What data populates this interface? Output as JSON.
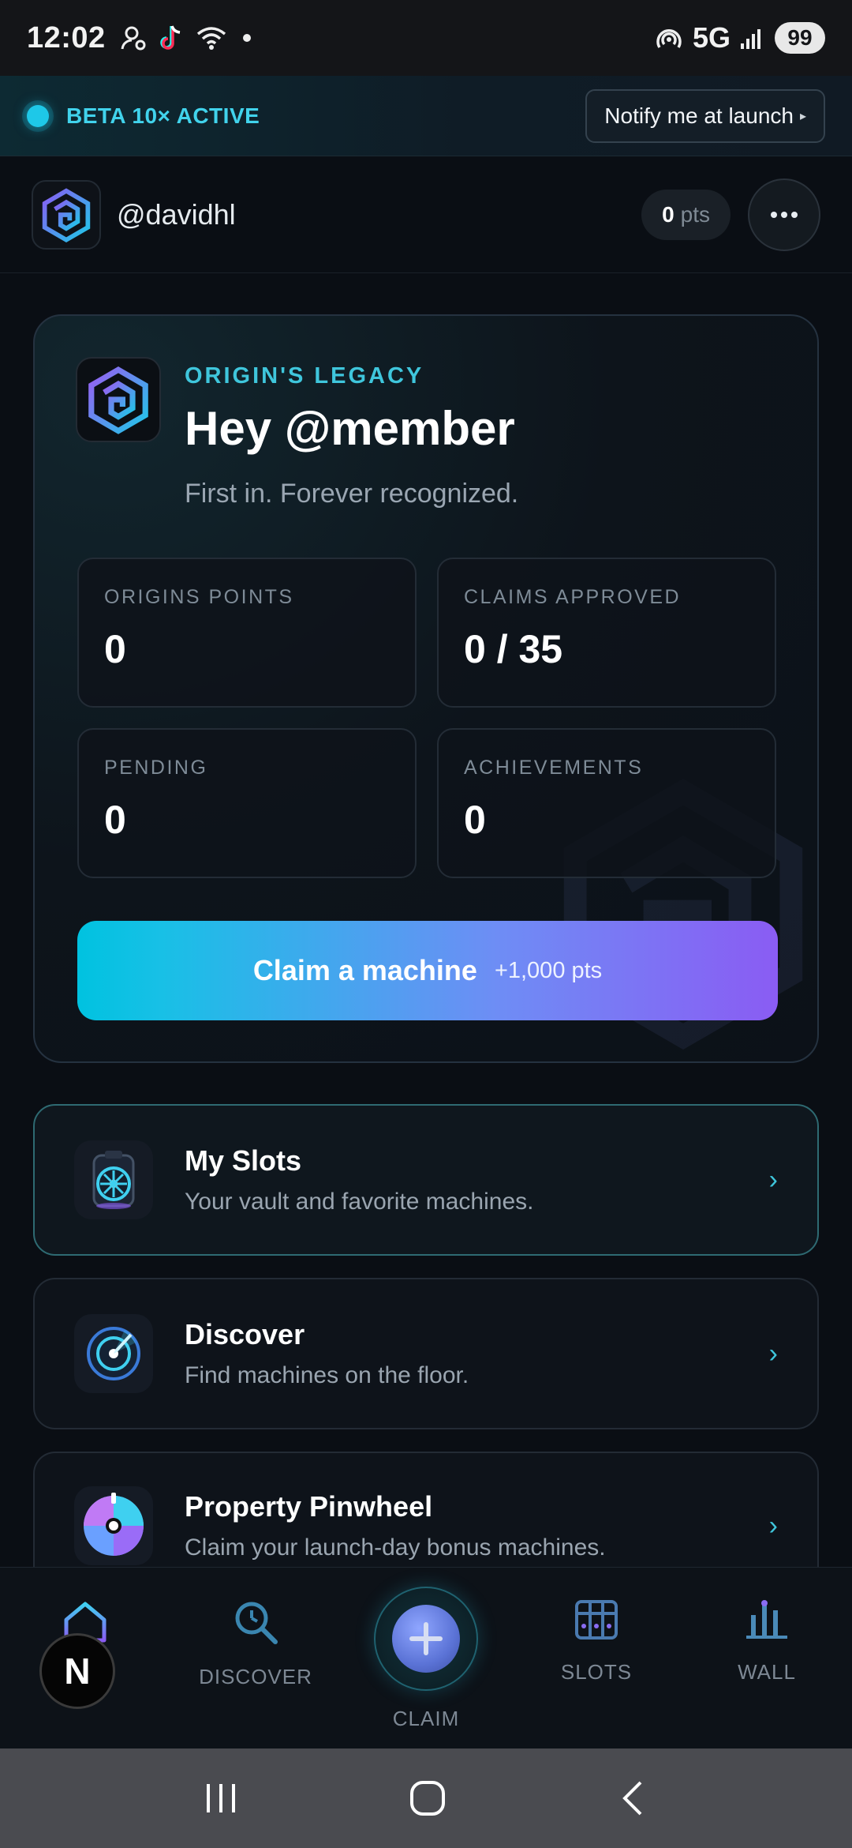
{
  "status_bar": {
    "time": "12:02",
    "network": "5G",
    "battery": "99"
  },
  "banner": {
    "status": "BETA 10× ACTIVE",
    "notify_label": "Notify me at launch",
    "accent": "#41d3ec"
  },
  "header": {
    "username": "@davidhl",
    "points_value": "0",
    "points_unit": "pts"
  },
  "legacy_card": {
    "eyebrow": "ORIGIN'S LEGACY",
    "greeting": "Hey @member",
    "tagline": "First in. Forever recognized.",
    "stats": [
      {
        "label": "ORIGINS POINTS",
        "value": "0"
      },
      {
        "label": "CLAIMS APPROVED",
        "value": "0 / 35"
      },
      {
        "label": "PENDING",
        "value": "0"
      },
      {
        "label": "ACHIEVEMENTS",
        "value": "0"
      }
    ],
    "claim_button": {
      "label": "Claim a machine",
      "bonus": "+1,000 pts"
    }
  },
  "nav_cards": [
    {
      "title": "My Slots",
      "subtitle": "Your vault and favorite machines.",
      "icon": "vault-icon"
    },
    {
      "title": "Discover",
      "subtitle": "Find machines on the floor.",
      "icon": "radar-icon"
    },
    {
      "title": "Property Pinwheel",
      "subtitle": "Claim your launch-day bonus machines.",
      "icon": "pinwheel-icon"
    }
  ],
  "bottom_nav": {
    "tabs": [
      {
        "label": "",
        "icon": "home-icon"
      },
      {
        "label": "DISCOVER",
        "icon": "search-icon"
      },
      {
        "label": "CLAIM",
        "icon": "plus-icon"
      },
      {
        "label": "SLOTS",
        "icon": "grid-icon"
      },
      {
        "label": "WALL",
        "icon": "bar-chart-icon"
      }
    ],
    "floating_badge": "N"
  }
}
